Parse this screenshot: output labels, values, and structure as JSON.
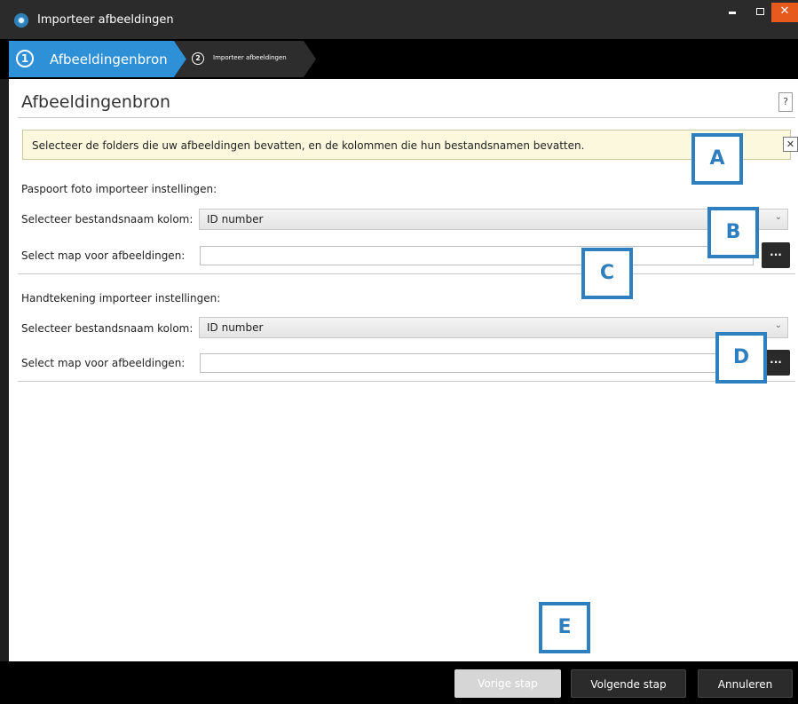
{
  "window": {
    "title": "Importeer afbeeldingen",
    "close_glyph": "✕"
  },
  "steps": [
    {
      "number": "1",
      "label": "Afbeeldingenbron",
      "active": true
    },
    {
      "number": "2",
      "label": "Importeer afbeeldingen",
      "active": false
    }
  ],
  "page": {
    "title": "Afbeeldingenbron",
    "help_label": "?"
  },
  "banner": {
    "text": "Selecteer de folders die uw afbeeldingen bevatten, en de kolommen die hun bestandsnamen bevatten.",
    "close_glyph": "✕"
  },
  "passport": {
    "heading": "Paspoort foto importeer instellingen:",
    "column_label": "Selecteer bestandsnaam kolom:",
    "column_value": "ID number",
    "folder_label": "Select map voor afbeeldingen:",
    "folder_value": "",
    "browse_label": "..."
  },
  "signature": {
    "heading": "Handtekening importeer instellingen:",
    "column_label": "Selecteer bestandsnaam kolom:",
    "column_value": "ID number",
    "folder_label": "Select map voor afbeeldingen:",
    "folder_value": "",
    "browse_label": "..."
  },
  "callouts": [
    "A",
    "B",
    "C",
    "D",
    "E"
  ],
  "footer": {
    "prev_label": "Vorige stap",
    "next_label": "Volgende stap",
    "cancel_label": "Annuleren"
  },
  "colors": {
    "accent": "#2e90d6",
    "callout": "#2e7fbf",
    "close": "#e65a1e",
    "banner_bg": "#fbf8dd"
  }
}
